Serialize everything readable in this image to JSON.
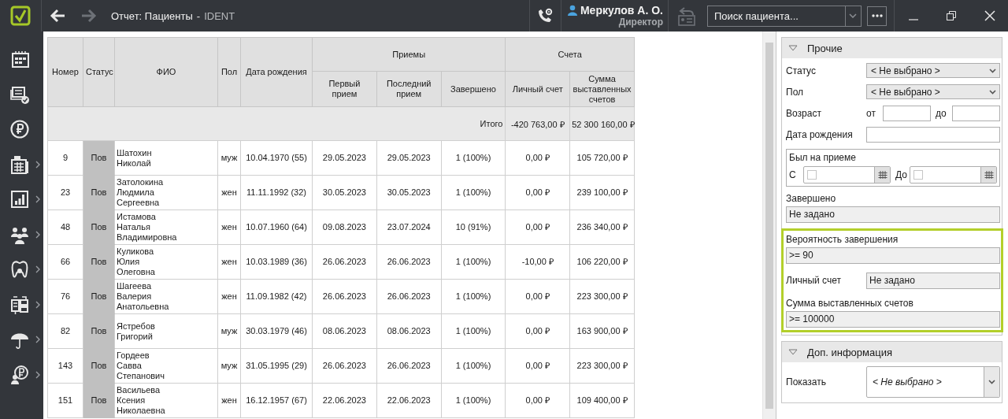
{
  "window": {
    "title": "Отчет: Пациенты",
    "separator": "-",
    "app": "IDENT"
  },
  "nav": {
    "back_enabled": true,
    "forward_enabled": false
  },
  "user": {
    "name": "Меркулов А. О.",
    "role": "Директор"
  },
  "search": {
    "placeholder": "Поиск пациента..."
  },
  "sidebar": {
    "items": [
      {
        "has_submenu": false
      },
      {
        "has_submenu": false
      },
      {
        "has_submenu": false
      },
      {
        "has_submenu": true
      },
      {
        "has_submenu": true
      },
      {
        "has_submenu": true
      },
      {
        "has_submenu": true
      },
      {
        "has_submenu": true
      },
      {
        "has_submenu": true
      },
      {
        "has_submenu": true
      }
    ]
  },
  "table": {
    "columns": [
      {
        "label": "Номер"
      },
      {
        "label": "Статус"
      },
      {
        "label": "ФИО"
      },
      {
        "label": "Пол"
      },
      {
        "label": "Дата рождения"
      },
      {
        "label": "Приемы",
        "children": [
          {
            "label": "Первый прием"
          },
          {
            "label": "Последний прием"
          },
          {
            "label": "Завершено"
          }
        ]
      },
      {
        "label": "Счета",
        "children": [
          {
            "label": "Личный счет"
          },
          {
            "label": "Сумма выставленных счетов"
          }
        ]
      }
    ],
    "total": {
      "label": "Итого",
      "values": [
        "-420 763,00 ₽",
        "52 300 160,00 ₽"
      ]
    },
    "rows": [
      {
        "number": "9",
        "status": "Пов",
        "name": "Шатохин\nНиколай",
        "sex": "муж",
        "birth": "10.04.1970 (55)",
        "first": "29.05.2023",
        "last": "29.05.2023",
        "done": "1 (100%)",
        "account": "0,00 ₽",
        "billed": "105 720,00 ₽"
      },
      {
        "number": "23",
        "status": "Пов",
        "name": "Затолокина\nЛюдмила\nСергеевна",
        "sex": "жен",
        "birth": "11.11.1992 (32)",
        "first": "30.05.2023",
        "last": "30.05.2023",
        "done": "1 (100%)",
        "account": "0,00 ₽",
        "billed": "239 100,00 ₽"
      },
      {
        "number": "48",
        "status": "Пов",
        "name": "Истамова\nНаталья\nВладимировна",
        "sex": "жен",
        "birth": "10.07.1960 (64)",
        "first": "09.08.2023",
        "last": "23.07.2024",
        "done": "10 (91%)",
        "account": "0,00 ₽",
        "billed": "236 340,00 ₽"
      },
      {
        "number": "66",
        "status": "Пов",
        "name": "Куликова\nЮлия\nОлеговна",
        "sex": "жен",
        "birth": "10.03.1989 (36)",
        "first": "26.06.2023",
        "last": "26.06.2023",
        "done": "1 (100%)",
        "account": "-10,00 ₽",
        "billed": "106 220,00 ₽"
      },
      {
        "number": "76",
        "status": "Пов",
        "name": "Шагеева\nВалерия\nАнатольевна",
        "sex": "жен",
        "birth": "11.09.1982 (42)",
        "first": "26.06.2023",
        "last": "26.06.2023",
        "done": "1 (100%)",
        "account": "0,00 ₽",
        "billed": "223 300,00 ₽"
      },
      {
        "number": "82",
        "status": "Пов",
        "name": "Ястребов\nГригорий",
        "sex": "муж",
        "birth": "30.03.1979 (46)",
        "first": "08.06.2023",
        "last": "08.06.2023",
        "done": "1 (100%)",
        "account": "0,00 ₽",
        "billed": "163 900,00 ₽"
      },
      {
        "number": "143",
        "status": "Пов",
        "name": "Гордеев\nСавва\nСтепанович",
        "sex": "муж",
        "birth": "31.05.1995 (29)",
        "first": "26.06.2023",
        "last": "26.06.2023",
        "done": "1 (100%)",
        "account": "0,00 ₽",
        "billed": "223 300,00 ₽"
      },
      {
        "number": "151",
        "status": "Пов",
        "name": "Васильева\nКсения\nНиколаевна",
        "sex": "жен",
        "birth": "16.12.1957 (67)",
        "first": "22.06.2023",
        "last": "22.06.2023",
        "done": "1 (100%)",
        "account": "0,00 ₽",
        "billed": "109 400,00 ₽"
      }
    ]
  },
  "filters": {
    "sections": [
      {
        "title": "Прочие",
        "expanded": true,
        "items": [
          {
            "kind": "select",
            "label": "Статус",
            "value": "< Не выбрано >"
          },
          {
            "kind": "select",
            "label": "Пол",
            "value": "< Не выбрано >"
          },
          {
            "kind": "range",
            "label": "Возраст",
            "from_label": "от",
            "to_label": "до"
          },
          {
            "kind": "text",
            "label": "Дата рождения"
          },
          {
            "kind": "date_range",
            "label": "Был на приеме",
            "from_label": "С",
            "to_label": "До",
            "from_checked": false,
            "to_checked": false
          },
          {
            "kind": "readonly",
            "label": "Завершено",
            "value": "Не задано"
          },
          {
            "kind": "group",
            "highlighted": true,
            "items": [
              {
                "kind": "readonly",
                "label": "Вероятность завершения",
                "value": ">= 90"
              },
              {
                "kind": "readonly_inline",
                "label": "Личный счет",
                "value": "Не задано"
              },
              {
                "kind": "readonly",
                "label": "Сумма выставленных счетов",
                "value": ">= 100000"
              }
            ]
          }
        ]
      },
      {
        "title": "Доп. информация",
        "expanded": true,
        "items": [
          {
            "kind": "picker",
            "label": "Показать",
            "value": "< Не выбрано >"
          }
        ]
      }
    ]
  }
}
